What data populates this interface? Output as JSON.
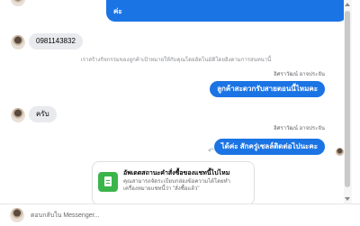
{
  "messages": {
    "top_partial_out": "ค่ะ",
    "phone_in": "0981143832",
    "system_notice": "เราสร้างกิจกรรมของลูกค้าเป้าหมายให้กับคุณโดยอัตโนมัติโดยอิงตามการสนทนานี้",
    "sender_name_1": "อิศราวัฒน์ อาจประจัน",
    "out_1": "ลูกค้าสะดวกรับสายตอนนี้ไหมคะ",
    "in_2": "ครับ",
    "sender_name_2": "อิศราวัฒน์ อาจประจัน",
    "out_2": "ได้ค่ะ สักครู่เซลล์ติดต่อไปนะคะ"
  },
  "card": {
    "title": "อัพเดตสถานะคำสั่งซื้อของแชทนี้ไปไหม",
    "description": "คุณสามารถจัดระเบียบกล่องข้อความได้โดยทำเครื่องหมายแชทนี้ว่า \"สั่งซื้อแล้ว\""
  },
  "composer": {
    "placeholder": "ตอบกลับใน Messenger..."
  },
  "colors": {
    "outgoing_bubble": "#1b74e4",
    "incoming_bubble": "#e9eaed",
    "card_icon": "#3bb54a"
  },
  "icons": [
    "reply-icon",
    "react-icon",
    "document-icon"
  ]
}
